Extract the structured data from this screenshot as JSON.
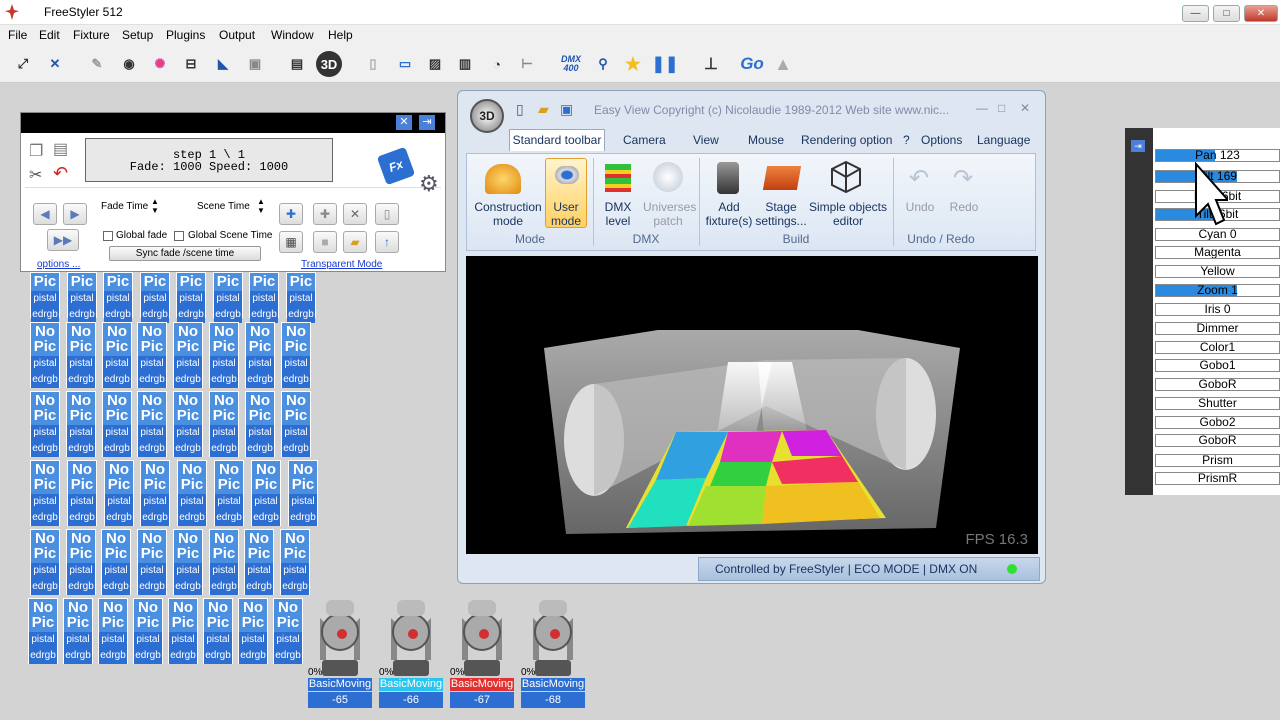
{
  "window": {
    "title": "FreeStyler 512",
    "min": "—",
    "max": "□",
    "close": "✕"
  },
  "menu": [
    "File",
    "Edit",
    "Fixture",
    "Setup",
    "Plugins",
    "Output",
    "Window",
    "Help"
  ],
  "toolbar": {
    "dmx_badge": "DMX\n400",
    "go": "Go"
  },
  "sequence": {
    "info_line1": "step 1 \\ 1",
    "info_line2": "Fade: 1000 Speed: 1000",
    "fade_time": "Fade Time",
    "scene_time": "Scene Time",
    "global_fade": "Global fade",
    "global_scene_time": "Global Scene Time",
    "sync": "Sync fade /scene time",
    "options": "options ...",
    "transparent": "Transparent Mode",
    "fx": "Fx"
  },
  "fixture_tile": {
    "top": "No",
    "mid": "Pic",
    "line1": "pistal",
    "line2": "edrgb"
  },
  "fixture_tile_top_row": {
    "top": "Pic",
    "line1": "pistal",
    "line2": "edrgb"
  },
  "moving_heads": [
    {
      "pct": "0%",
      "name": "BasicMoving",
      "num": "-65",
      "color": "#2d6ed3"
    },
    {
      "pct": "0%",
      "name": "BasicMoving",
      "num": "-66",
      "color": "#27c6f0"
    },
    {
      "pct": "0%",
      "name": "BasicMoving",
      "num": "-67",
      "color": "#e23030"
    },
    {
      "pct": "0%",
      "name": "BasicMoving",
      "num": "-68",
      "color": "#2d6ed3"
    }
  ],
  "easyview": {
    "title": "Easy View  Copyright (c) Nicolaudie 1989-2012  Web site www.nic...",
    "tabs": [
      "Standard toolbar",
      "Camera",
      "View",
      "Mouse",
      "Rendering option"
    ],
    "help": "?",
    "options": "Options",
    "language": "Language",
    "buttons": [
      {
        "label": "Construction\nmode"
      },
      {
        "label": "User\nmode"
      },
      {
        "label": "DMX\nlevel"
      },
      {
        "label": "Universes\npatch"
      },
      {
        "label": "Add\nfixture(s)"
      },
      {
        "label": "Stage\nsettings..."
      },
      {
        "label": "Simple objects\neditor"
      },
      {
        "label": "Undo"
      },
      {
        "label": "Redo"
      }
    ],
    "groups": [
      "Mode",
      "DMX",
      "Build",
      "Undo / Redo"
    ],
    "fps": "FPS 16.3",
    "status": "Controlled by FreeStyler  |  ECO MODE  |  DMX ON"
  },
  "channels": [
    {
      "label": "Pan",
      "value": "123",
      "level": 0.48
    },
    {
      "label": "Tilt",
      "value": "169",
      "level": 0.66
    },
    {
      "label": "Pan16bit",
      "value": "",
      "level": 0
    },
    {
      "label": "Tilt16bit",
      "value": "",
      "level": 0.5
    },
    {
      "label": "Cyan",
      "value": "0",
      "level": 0
    },
    {
      "label": "Magenta",
      "value": "",
      "level": 0
    },
    {
      "label": "Yellow",
      "value": "",
      "level": 0
    },
    {
      "label": "Zoom",
      "value": "1",
      "level": 0.66
    },
    {
      "label": "Iris",
      "value": "0",
      "level": 0
    },
    {
      "label": "Dimmer",
      "value": "",
      "level": 0
    },
    {
      "label": "Color1",
      "value": "",
      "level": 0
    },
    {
      "label": "Gobo1",
      "value": "",
      "level": 0
    },
    {
      "label": "GoboR",
      "value": "",
      "level": 0
    },
    {
      "label": "Shutter",
      "value": "",
      "level": 0
    },
    {
      "label": "Gobo2",
      "value": "",
      "level": 0
    },
    {
      "label": "GoboR",
      "value": "",
      "level": 0
    },
    {
      "label": "Prism",
      "value": "",
      "level": 0
    },
    {
      "label": "PrismR",
      "value": "",
      "level": 0
    }
  ],
  "colors": {
    "accent": "#2d6ed3",
    "tile": "#4a8fe0"
  }
}
